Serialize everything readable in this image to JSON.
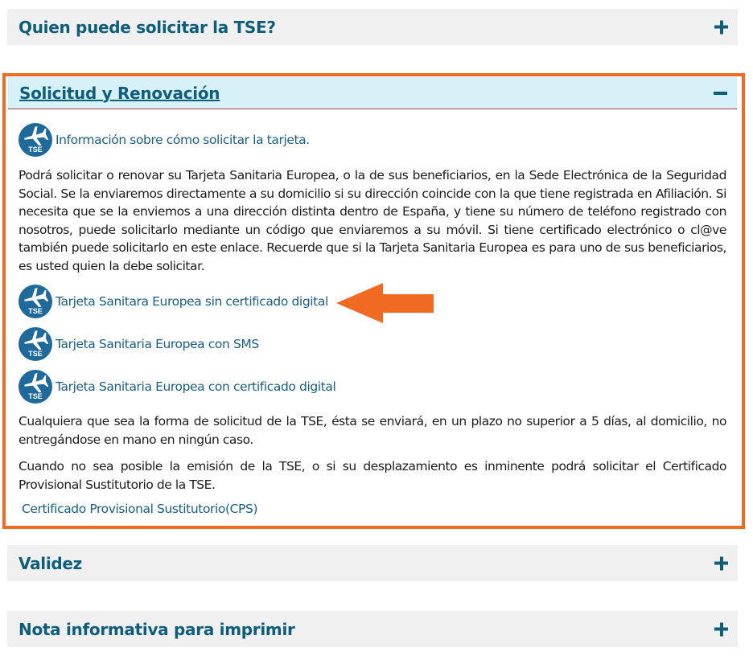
{
  "accordion": {
    "quien": {
      "title": "Quien puede solicitar la TSE?"
    },
    "solicitud": {
      "title": "Solicitud y Renovación"
    },
    "validez": {
      "title": "Validez"
    },
    "nota": {
      "title": "Nota informativa para imprimir"
    }
  },
  "solicitud_content": {
    "info_link": "Información sobre cómo solicitar la tarjeta.",
    "intro_paragraph": "Podrá solicitar o renovar su Tarjeta Sanitaria Europea, o la de sus beneficiarios, en la Sede Electrónica de la Seguridad Social. Se la enviaremos directamente a su domicilio si su dirección coincide con la que tiene registrada en Afiliación. Si necesita que se la enviemos a una dirección distinta dentro de España, y tiene su número de teléfono registrado con nosotros, puede solicitarlo mediante un código que enviaremos a su móvil. Si tiene certificado electrónico o cl@ve también puede solicitarlo en este enlace. Recuerde que si la Tarjeta Sanitaria Europea es para uno de sus beneficiarios, es usted quien la debe solicitar.",
    "links": [
      {
        "label": "Tarjeta Sanitara Europea sin certificado digital"
      },
      {
        "label": "Tarjeta Sanitaria Europea con SMS"
      },
      {
        "label": "Tarjeta Sanitaria Europea con certificado digital"
      }
    ],
    "delivery_paragraph": "Cualquiera que sea la forma de solicitud de la TSE, ésta se enviará, en un plazo no superior a 5 días, al domicilio, no entregándose en mano en ningún caso.",
    "provisional_paragraph": "Cuando no sea posible la emisión de la TSE, o si su desplazamiento es inminente podrá solicitar el Certificado Provisional Sustitutorio de la TSE.",
    "cps_link": "Certificado Provisional Sustitutorio(CPS)"
  },
  "icons": {
    "tse_icon_text": "TSE",
    "tse_icon": "airplane-tse-icon"
  },
  "colors": {
    "accent": "#0e5d7a",
    "highlight": "#f06a22",
    "open_header_bg": "#d7f1f9",
    "link": "#1b5f80"
  }
}
